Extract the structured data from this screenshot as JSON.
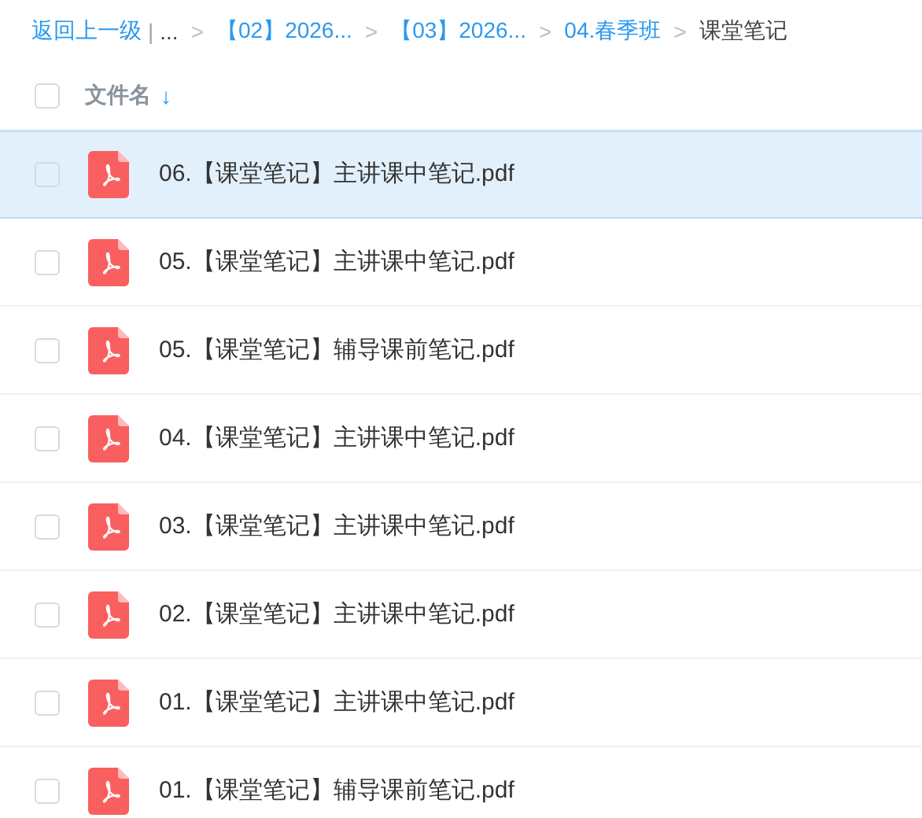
{
  "breadcrumb": {
    "back": "返回上一级",
    "divider": "|",
    "items": [
      {
        "label": "...",
        "link": false
      },
      {
        "separator": ">",
        "label": "【02】2026...",
        "link": true
      },
      {
        "separator": ">",
        "label": "【03】2026...",
        "link": true
      },
      {
        "separator": ">",
        "label": "04.春季班",
        "link": true
      },
      {
        "separator": ">",
        "label": "课堂笔记",
        "link": false
      }
    ]
  },
  "header": {
    "checked": false,
    "column": "文件名",
    "sort_arrow": "↓"
  },
  "files": [
    {
      "name": "06.【课堂笔记】主讲课中笔记.pdf",
      "checked": false,
      "highlighted": true
    },
    {
      "name": "05.【课堂笔记】主讲课中笔记.pdf",
      "checked": false,
      "highlighted": false
    },
    {
      "name": "05.【课堂笔记】辅导课前笔记.pdf",
      "checked": false,
      "highlighted": false
    },
    {
      "name": "04.【课堂笔记】主讲课中笔记.pdf",
      "checked": false,
      "highlighted": false
    },
    {
      "name": "03.【课堂笔记】主讲课中笔记.pdf",
      "checked": false,
      "highlighted": false
    },
    {
      "name": "02.【课堂笔记】主讲课中笔记.pdf",
      "checked": false,
      "highlighted": false
    },
    {
      "name": "01.【课堂笔记】主讲课中笔记.pdf",
      "checked": false,
      "highlighted": false
    },
    {
      "name": "01.【课堂笔记】辅导课前笔记.pdf",
      "checked": false,
      "highlighted": false
    }
  ]
}
